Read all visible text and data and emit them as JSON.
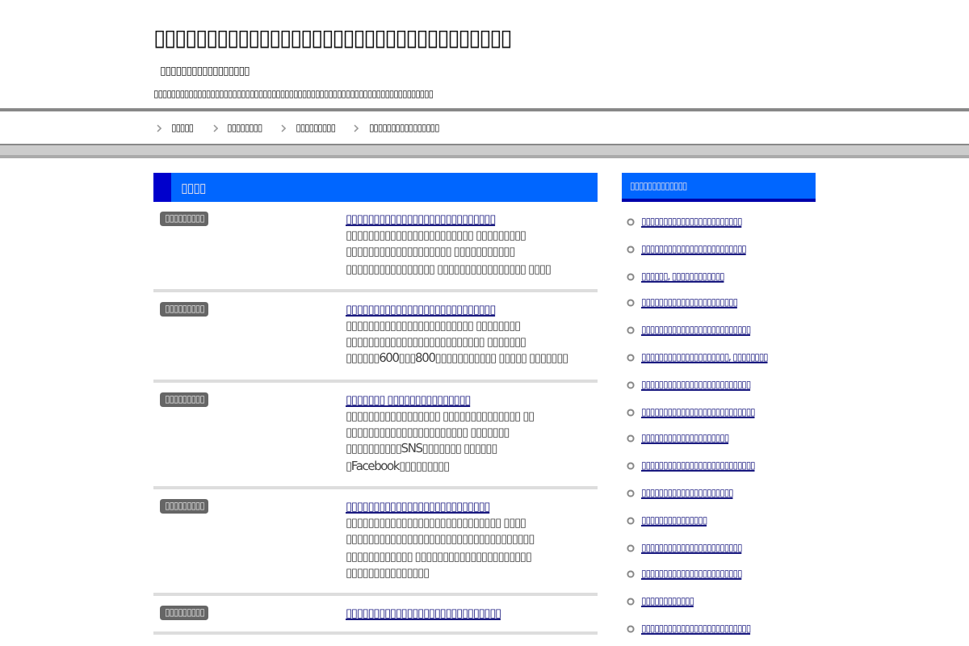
{
  "site": {
    "title": "▯▯▯▯▯▯▯▯▯▯▯▯▯▯▯▯▯▯▯▯▯▯▯▯▯▯▯▯▯▯▯▯▯▯",
    "tagline": "▯▯▯▯▯▯▯▯▯▯▯▯▯▯▯▯▯",
    "description": "▯▯▯▯▯▯▯▯▯▯▯▯▯▯▯▯▯▯▯▯▯▯▯▯▯▯▯▯▯▯▯▯▯▯▯▯▯▯▯▯▯▯▯▯▯▯▯▯▯▯▯▯▯▯▯▯▯▯▯▯▯▯▯▯"
  },
  "nav": [
    "▯▯▯▯▯",
    "▯▯▯▯▯▯▯▯",
    "▯▯▯▯▯▯▯▯▯",
    "▯▯▯▯▯▯▯▯▯▯▯▯▯▯▯▯"
  ],
  "main": {
    "heading": "▯▯▯▯",
    "articles": [
      {
        "date": "▯▯▯▯▯▯▯▯▯",
        "title": "▯▯▯▯▯▯▯▯▯▯▯▯▯▯▯▯▯▯▯▯▯▯▯▯▯▯▯",
        "excerpt": "▯▯▯▯▯▯▯▯▯▯▯▯▯▯▯▯▯▯▯▯▯▯▯ ▯▯▯▯▯▯▯▯▯ ▯▯▯▯▯▯▯▯▯▯▯▯▯▯▯▯▯▯▯  ▯▯▯▯▯▯▯▯▯▯▯ ▯▯▯▯▯▯▯▯▯▯▯▯▯▯▯▯  ▯▯▯▯▯▯▯▯▯▯▯▯▯▯▯▯ ▯▯▯▯"
      },
      {
        "date": "▯▯▯▯▯▯▯▯▯",
        "title": "▯▯▯▯▯▯▯▯▯▯▯▯▯▯▯▯▯▯▯▯▯▯▯▯▯▯▯",
        "excerpt": "▯▯▯▯▯▯▯▯▯▯▯▯▯▯▯▯▯▯▯▯▯▯▯  ▯▯▯▯▯▯▯▯ ▯▯▯▯▯▯▯▯▯▯▯▯▯▯▯▯▯▯▯▯▯▯▯▯▯ ▯▯▯▯▯▯▯ ▯▯▯▯▯▯600▯▯▯800▯▯▯▯▯▯▯▯▯▯▯ ▯▯▯▯▯ ▯▯▯▯▯▯▯"
      },
      {
        "date": "▯▯▯▯▯▯▯▯▯",
        "title": "▯▯▯▯▯▯▯ ▯▯▯▯▯▯▯▯▯▯▯▯▯▯▯",
        "excerpt": "▯▯▯▯▯▯▯▯▯▯▯▯▯▯▯▯▯ ▯▯▯▯▯▯▯▯▯▯▯▯▯▯ ▯▯ ▯▯▯▯▯▯▯▯▯▯▯▯▯▯▯▯▯▯▯▯▯▯ ▯▯▯▯▯▯▯ ▯▯▯▯▯▯▯▯▯▯SNS▯▯▯▯▯▯▯ ▯▯▯▯▯▯ ▯Facebook▯▯▯▯▯▯▯▯▯"
      },
      {
        "date": "▯▯▯▯▯▯▯▯▯",
        "title": "▯▯▯▯▯▯▯▯▯▯▯▯▯▯▯▯▯▯▯▯▯▯▯▯▯▯",
        "excerpt": "▯▯▯▯▯▯▯▯▯▯▯▯▯▯▯▯▯▯▯▯▯▯▯▯▯▯▯▯ ▯▯▯▯ ▯▯▯▯▯▯▯▯▯▯▯▯▯▯▯▯▯▯▯▯▯▯▯▯▯▯▯▯▯▯▯▯▯▯ ▯▯▯▯▯▯▯▯▯▯▯▯ ▯▯▯▯▯▯▯▯▯▯▯▯▯▯▯▯▯▯▯▯▯ ▯▯▯▯▯▯▯▯▯▯▯▯▯▯▯"
      },
      {
        "date": "▯▯▯▯▯▯▯▯▯",
        "title": "▯▯▯▯▯▯▯▯▯▯▯▯▯▯▯▯▯▯▯▯▯▯▯▯▯▯▯▯"
      }
    ]
  },
  "sidebar": {
    "heading": "▯▯▯▯▯▯▯▯▯▯▯▯▯",
    "links": [
      "▯▯▯▯▯▯▯▯▯▯▯▯▯▯▯▯▯▯▯▯▯▯▯",
      "▯▯▯▯▯▯▯▯▯▯▯▯▯▯▯▯▯▯▯▯▯▯▯▯",
      "▯▯▯▯▯▯, ▯▯▯▯▯▯▯▯▯▯▯▯",
      "▯▯▯▯▯▯▯▯▯▯▯▯▯▯▯▯▯▯▯▯▯▯",
      "▯▯▯▯▯▯▯▯▯▯▯▯▯▯▯▯▯▯▯▯▯▯▯▯▯",
      "▯▯▯▯▯▯▯▯▯▯▯▯▯▯▯▯▯▯▯▯, ▯▯▯▯▯▯▯▯",
      "▯▯▯▯▯▯▯▯▯▯▯▯▯▯▯▯▯▯▯▯▯▯▯▯▯",
      "▯▯▯▯▯▯▯▯▯▯▯▯▯▯▯▯▯▯▯▯▯▯▯▯▯▯",
      "▯▯▯▯▯▯▯▯▯▯▯▯▯▯▯▯▯▯▯▯",
      "▯▯▯▯▯▯▯▯▯▯▯▯▯▯▯▯▯▯▯▯▯▯▯▯▯▯",
      "▯▯▯▯▯▯▯▯▯▯▯▯▯▯▯▯▯▯▯▯▯",
      "▯▯▯▯▯▯▯▯▯▯▯▯▯▯▯",
      "▯▯▯▯▯▯▯▯▯▯▯▯▯▯▯▯▯▯▯▯▯▯▯",
      "▯▯▯▯▯▯▯▯▯▯▯▯▯▯▯▯▯▯▯▯▯▯▯",
      "▯▯▯▯▯▯▯▯▯▯▯▯",
      "▯▯▯▯▯▯▯▯▯▯▯▯▯▯▯▯▯▯▯▯▯▯▯▯▯"
    ]
  }
}
